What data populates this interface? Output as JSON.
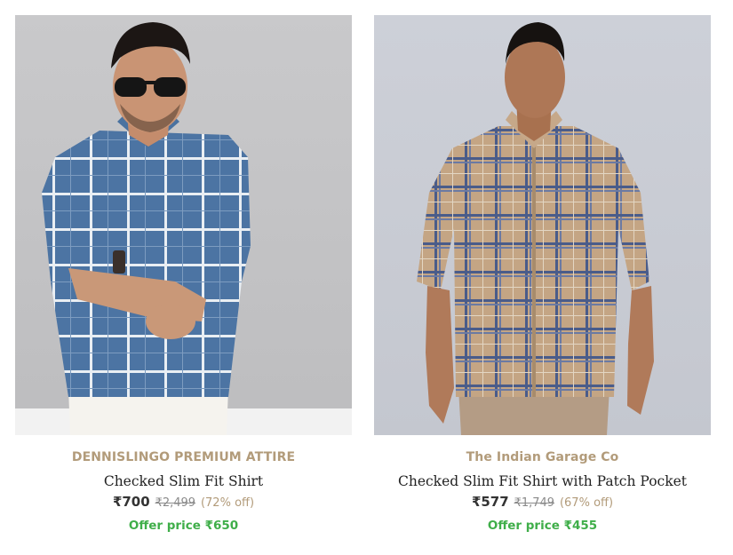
{
  "products": [
    {
      "brand": "DENNISLINGO PREMIUM ATTIRE",
      "title": "Checked Slim Fit Shirt",
      "price": "₹700",
      "mrp": "₹2,499",
      "discount": "(72% off)",
      "offer": "Offer price ₹650",
      "shirt_color": "#4c74a3",
      "check_color": "#e9eef3"
    },
    {
      "brand": "The Indian Garage Co",
      "title": "Checked Slim Fit Shirt with Patch Pocket",
      "price": "₹577",
      "mrp": "₹1,749",
      "discount": "(67% off)",
      "offer": "Offer price ₹455",
      "shirt_color": "#c4a584",
      "check_color": "#4a5c8a"
    }
  ],
  "colors": {
    "brand": "#b29b7a",
    "offer": "#3fae49",
    "price": "#333333"
  }
}
